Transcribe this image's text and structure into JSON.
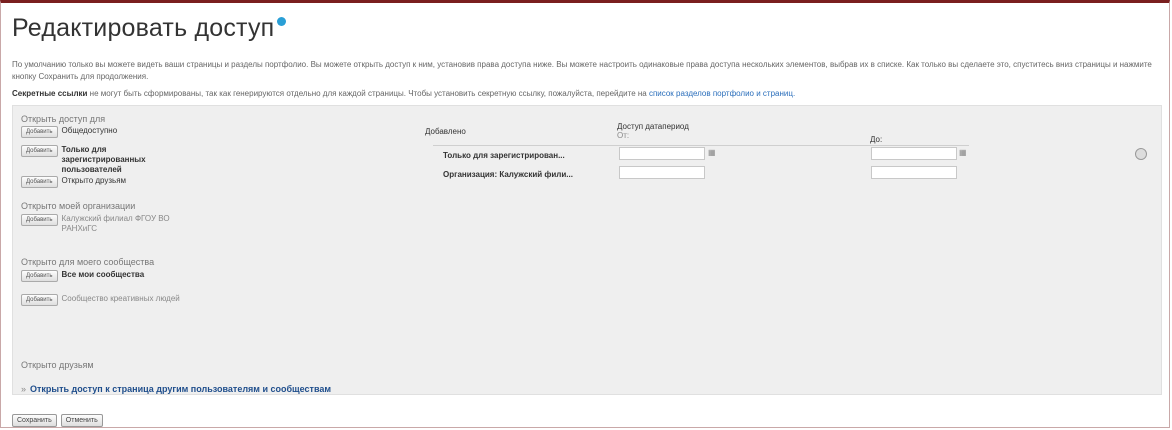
{
  "page": {
    "title": "Редактировать доступ",
    "description": "По умолчанию только вы можете видеть ваши страницы и разделы портфолио. Вы можете открыть доступ к ним, установив права доступа ниже. Вы можете настроить одинаковые права доступа нескольких элементов, выбрав их в списке. Как только вы сделаете это, спуститесь вниз страницы и нажмите кнопку Сохранить для продолжения.",
    "secret_bold": "Секретные ссылки",
    "secret_text": " не могут быть сформированы, так как генерируются отдельно для каждой страницы. Чтобы установить секретную ссылку, пожалуйста, перейдите на ",
    "secret_link": "список разделов портфолио и страниц."
  },
  "left": {
    "add_label": "Добавить",
    "sections": [
      {
        "title": "Открыть доступ для",
        "items": [
          "Общедоступно",
          "Только для зарегистрированных пользователей",
          "Открыто друзьям"
        ]
      },
      {
        "title": "Открыто моей организации",
        "items": [
          "Калужский филиал ФГОУ ВО РАНХиГС"
        ]
      },
      {
        "title": "Открыто для моего сообщества",
        "items": [
          "Все мои сообщества",
          "Сообщество креативных людей"
        ]
      },
      {
        "title": "Открыто друзьям",
        "items": []
      }
    ],
    "share_link": "Открыть доступ к страница другим пользователям и сообществам"
  },
  "table": {
    "added": "Добавлено",
    "access_dates": "Доступ датапериод",
    "from": "От:",
    "to": "До:",
    "rows": [
      "Только для зарегистрирован...",
      "Организация: Калужский фили..."
    ]
  },
  "footer": {
    "save": "Сохранить",
    "cancel": "Отменить"
  }
}
